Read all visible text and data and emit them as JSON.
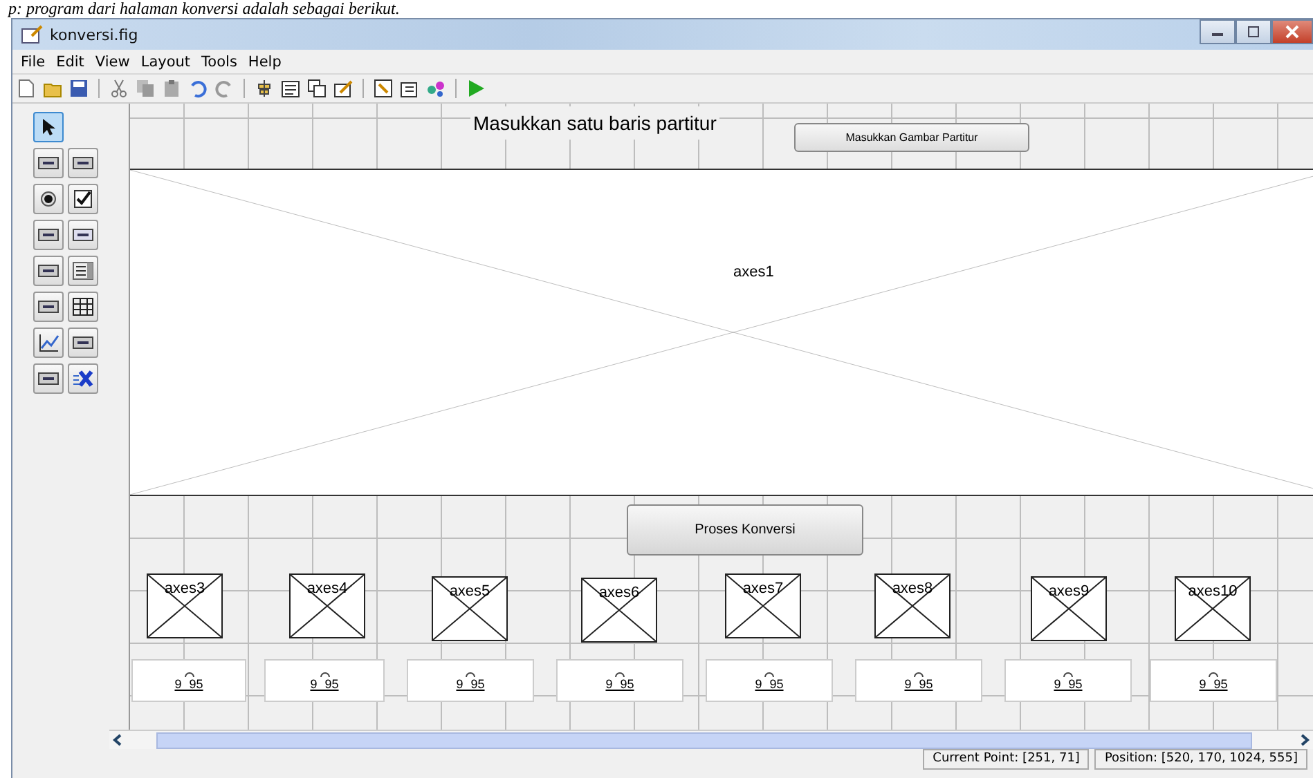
{
  "caption": "p: program dari halaman konversi adalah sebagai berikut.",
  "window": {
    "title": "konversi.fig"
  },
  "menu": [
    "File",
    "Edit",
    "View",
    "Layout",
    "Tools",
    "Help"
  ],
  "palette": [
    {
      "selected": true
    },
    {
      "selected": false
    },
    {
      "selected": false
    },
    {
      "selected": false
    },
    {
      "selected": false
    },
    {
      "selected": false
    },
    {
      "selected": false
    },
    {
      "selected": false
    },
    {
      "selected": false
    },
    {
      "selected": false
    },
    {
      "selected": false
    },
    {
      "selected": false
    },
    {
      "selected": false
    },
    {
      "selected": false
    },
    {
      "selected": false
    }
  ],
  "canvas": {
    "header_text": "Masukkan satu baris partitur",
    "image_button": "Masukkan Gambar Partitur",
    "main_axes": "axes1",
    "process_button": "Proses Konversi",
    "small_axes": [
      "axes3",
      "axes4",
      "axes5",
      "axes6",
      "axes7",
      "axes8",
      "axes9",
      "axes10"
    ],
    "note_boxes": [
      "9 95",
      "9 95",
      "9 95",
      "9 95",
      "9 95",
      "9 95",
      "9 95",
      "9 95"
    ]
  },
  "status_bar": {
    "current_point": "Current Point: [251, 71]",
    "position": "Position: [520, 170, 1024, 555]"
  }
}
